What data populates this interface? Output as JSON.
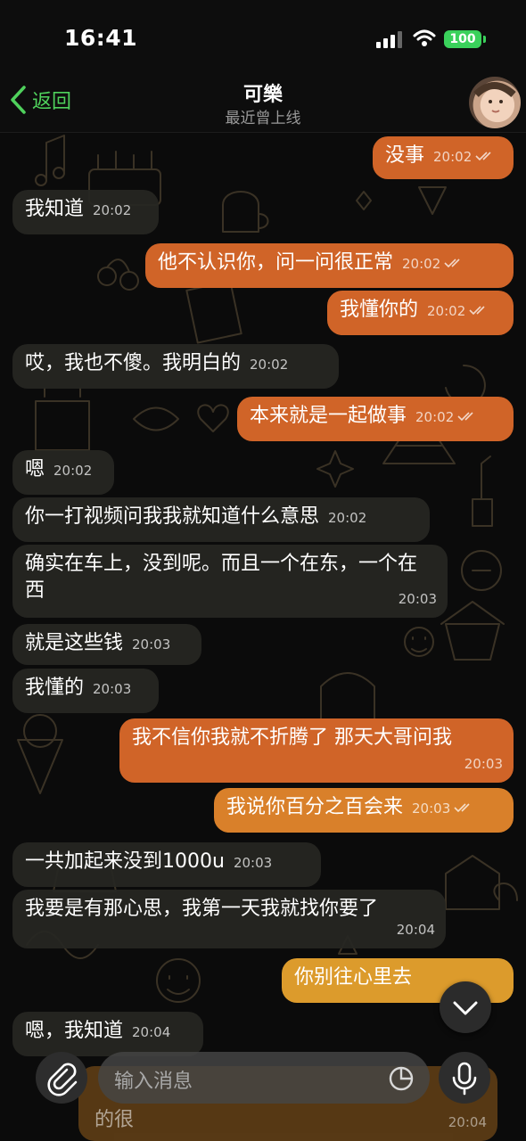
{
  "status_bar": {
    "time": "16:41",
    "battery": "100"
  },
  "header": {
    "back_label": "返回",
    "contact_name": "可樂",
    "last_seen": "最近曾上线"
  },
  "messages": [
    {
      "dir": "out",
      "text": "没事",
      "time": "20:02"
    },
    {
      "dir": "in",
      "text": "我知道",
      "time": "20:02"
    },
    {
      "dir": "out",
      "text": "他不认识你，问一问很正常",
      "time": "20:02"
    },
    {
      "dir": "out",
      "text": "我懂你的",
      "time": "20:02"
    },
    {
      "dir": "in",
      "text": "哎，我也不傻。我明白的",
      "time": "20:02"
    },
    {
      "dir": "out",
      "text": "本来就是一起做事",
      "time": "20:02"
    },
    {
      "dir": "in",
      "text": "嗯",
      "time": "20:02"
    },
    {
      "dir": "in",
      "text": "你一打视频问我我就知道什么意思",
      "time": "20:02"
    },
    {
      "dir": "in",
      "text": "确实在车上，没到呢。而且一个在东，一个在西",
      "time": "20:03"
    },
    {
      "dir": "in",
      "text": "就是这些钱",
      "time": "20:03"
    },
    {
      "dir": "in",
      "text": "我懂的",
      "time": "20:03"
    },
    {
      "dir": "out",
      "text": "我不信你我就不折腾了 那天大哥问我",
      "time": "20:03"
    },
    {
      "dir": "out",
      "text": "我说你百分之百会来",
      "time": "20:03"
    },
    {
      "dir": "in",
      "text": "一共加起来没到1000u",
      "time": "20:03"
    },
    {
      "dir": "in",
      "text": "我要是有那心思，我第一天我就找你要了",
      "time": "20:04"
    },
    {
      "dir": "out",
      "text": "你别往心里去",
      "time": ""
    },
    {
      "dir": "in",
      "text": "嗯，我知道",
      "time": "20:04"
    }
  ],
  "peek_message": {
    "text": "的很",
    "time": "20:04"
  },
  "composer": {
    "placeholder": "输入消息"
  },
  "colors": {
    "accent": "#4fd15c",
    "outgoing": "#d06428",
    "incoming": "#262622",
    "battery": "#3ad15b"
  }
}
